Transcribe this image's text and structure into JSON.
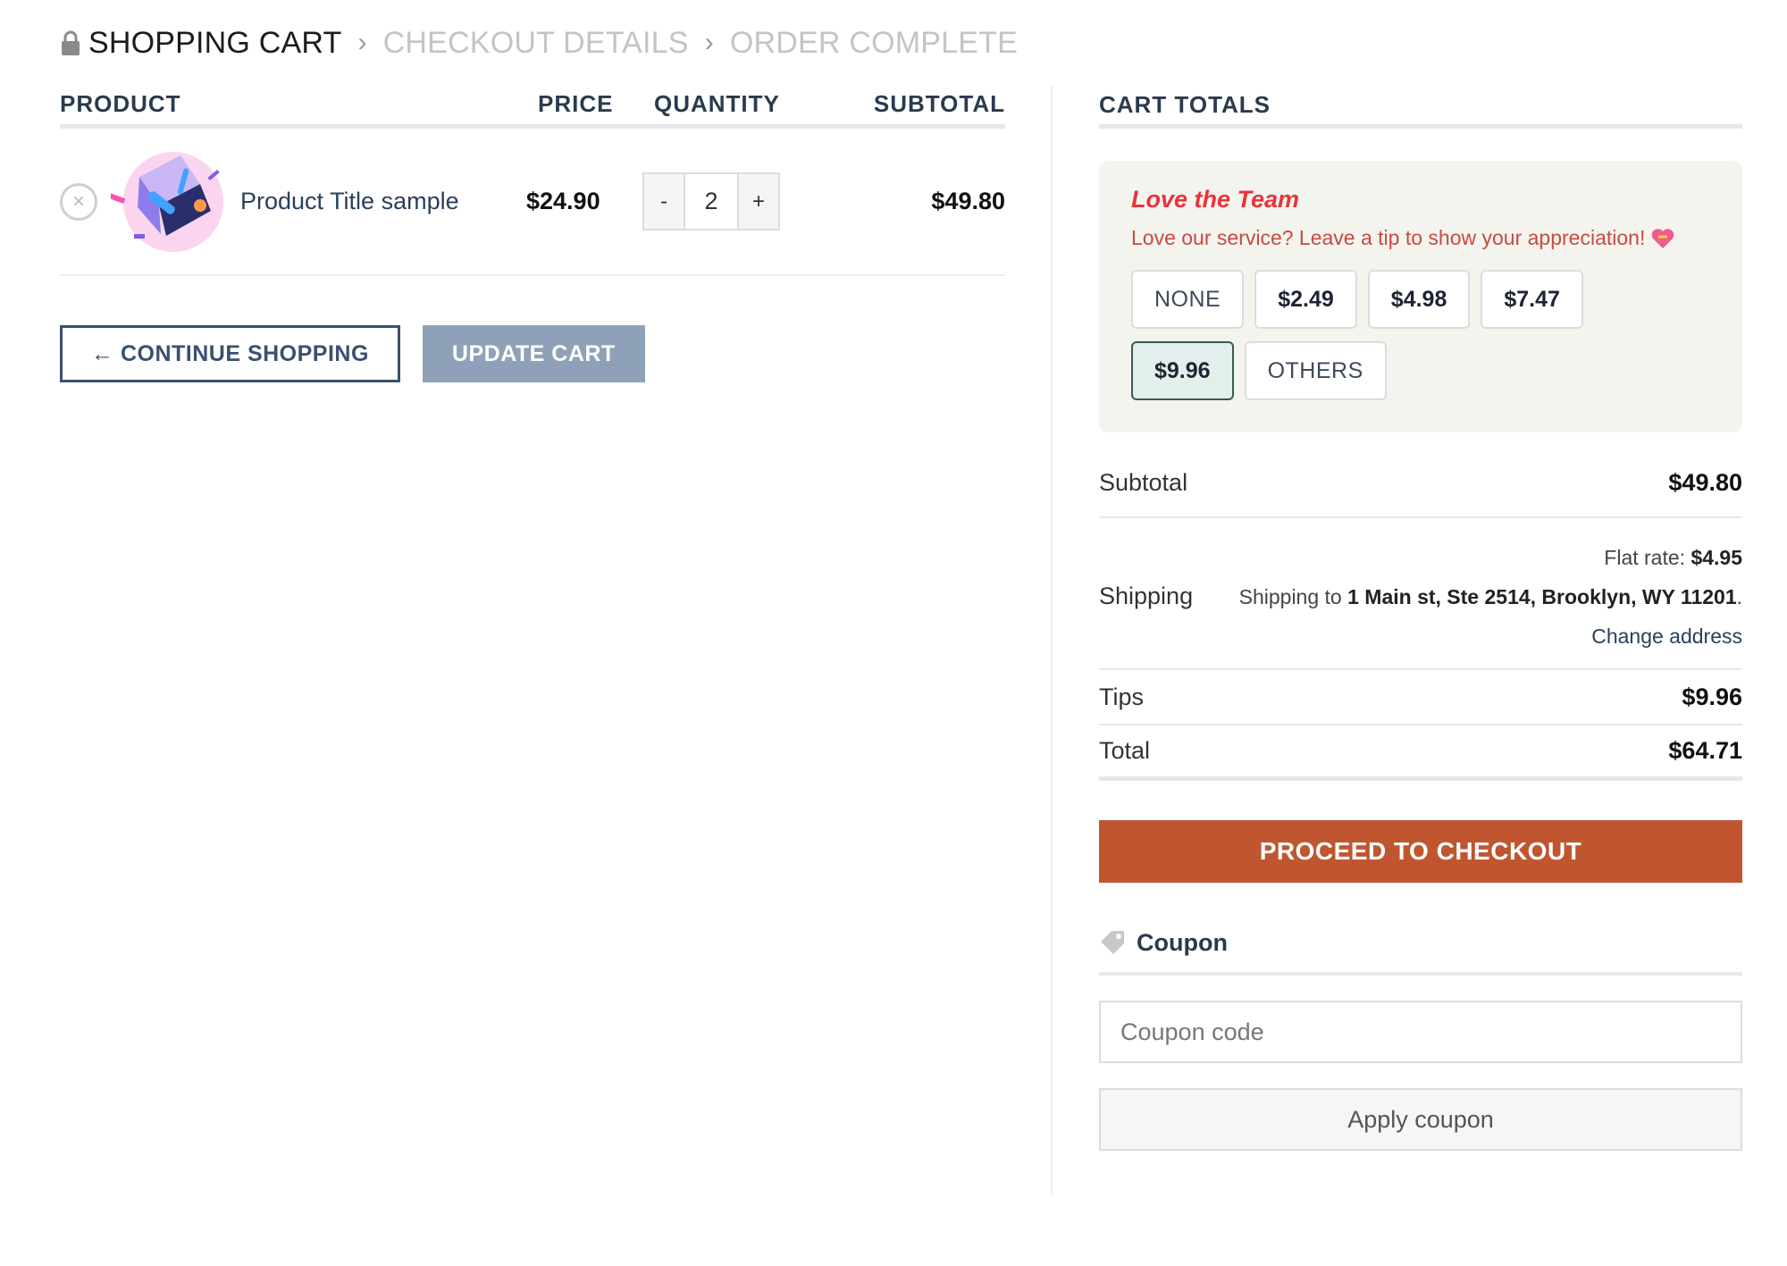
{
  "breadcrumb": {
    "active": "SHOPPING CART",
    "sep": "›",
    "step2": "CHECKOUT DETAILS",
    "step3": "ORDER COMPLETE"
  },
  "cart": {
    "headers": {
      "product": "PRODUCT",
      "price": "PRICE",
      "quantity": "QUANTITY",
      "subtotal": "SUBTOTAL"
    },
    "item": {
      "remove": "×",
      "name": "Product Title sample",
      "price": "$24.90",
      "quantity": "2",
      "subtotal": "$49.80"
    },
    "qty_minus": "-",
    "qty_plus": "+",
    "continue_label": "← CONTINUE SHOPPING",
    "update_label": "UPDATE CART"
  },
  "totals": {
    "heading": "CART TOTALS",
    "tip": {
      "title": "Love the Team",
      "desc": "Love our service? Leave a tip to show your appreciation!",
      "options": [
        "NONE",
        "$2.49",
        "$4.98",
        "$7.47",
        "$9.96",
        "OTHERS"
      ],
      "selected": "$9.96"
    },
    "subtotal_label": "Subtotal",
    "subtotal_value": "$49.80",
    "shipping_label": "Shipping",
    "flat_rate_label": "Flat rate:",
    "flat_rate_value": "$4.95",
    "shipping_to_prefix": "Shipping to",
    "shipping_address": "1 Main st, Ste 2514, Brooklyn, WY 11201",
    "change_address": "Change address",
    "tips_label": "Tips",
    "tips_value": "$9.96",
    "total_label": "Total",
    "total_value": "$64.71",
    "checkout_label": "PROCEED TO CHECKOUT"
  },
  "coupon": {
    "heading": "Coupon",
    "placeholder": "Coupon code",
    "apply_label": "Apply coupon"
  },
  "colors": {
    "checkout": "#bf5630",
    "accent_red": "#e8333b",
    "navy": "#2a3f5c",
    "update_btn": "#8fa1b8"
  }
}
